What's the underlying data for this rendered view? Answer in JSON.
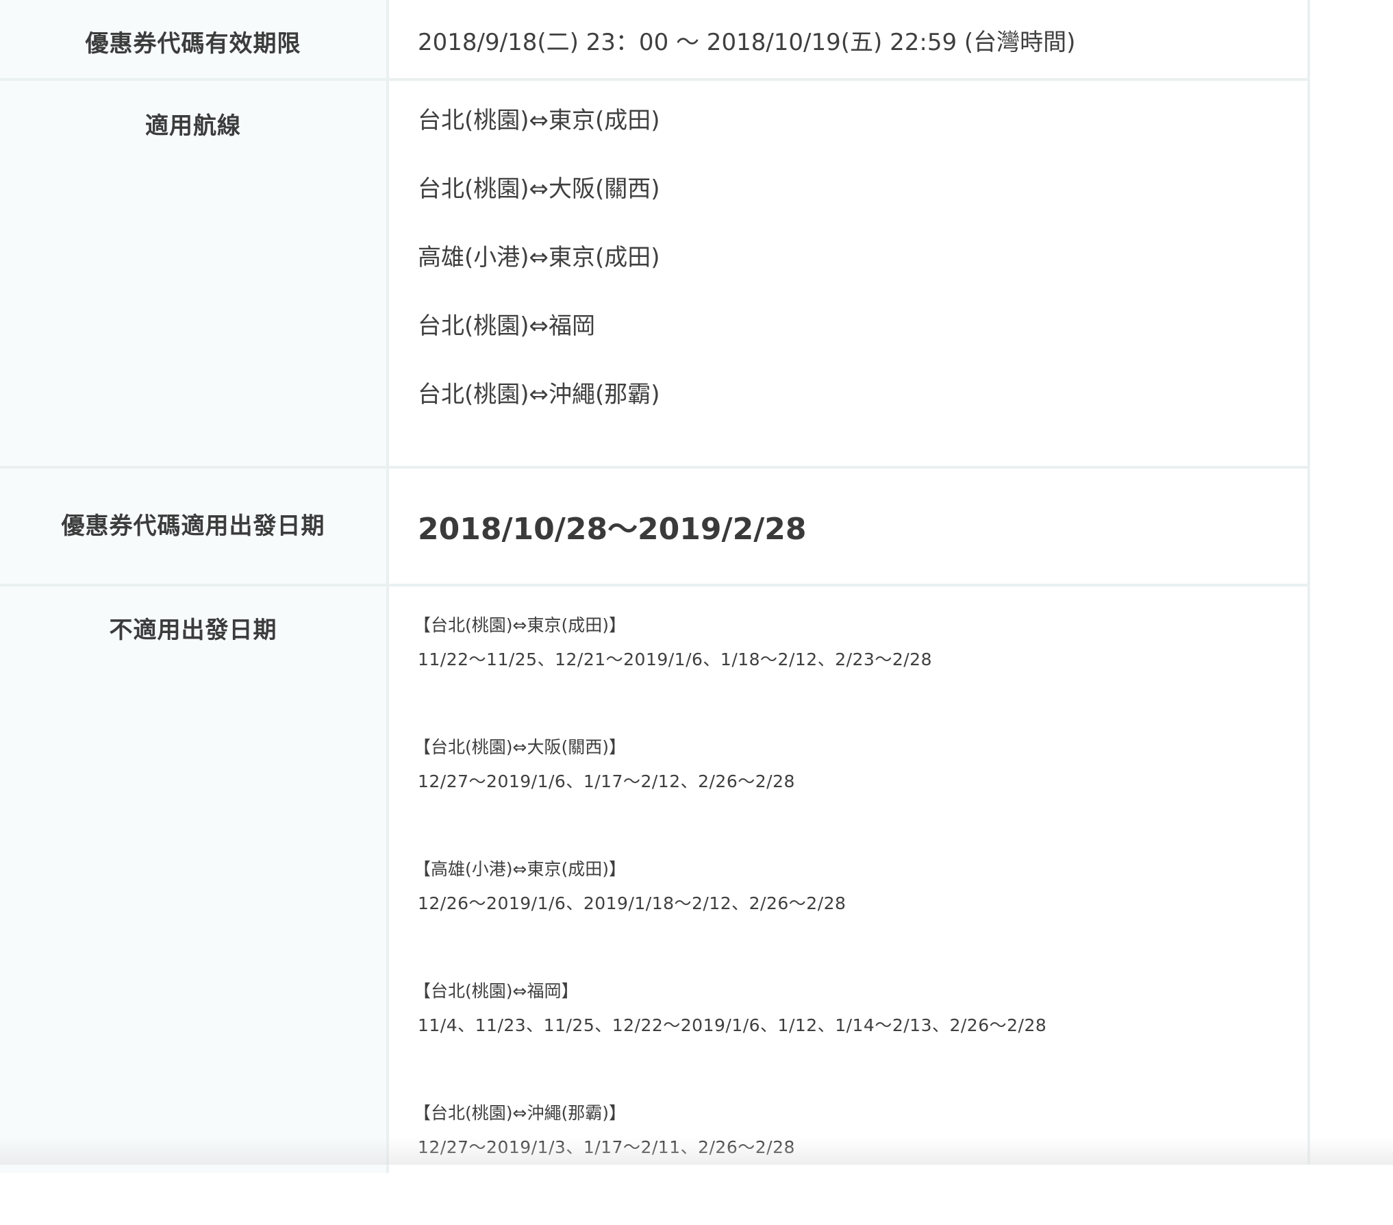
{
  "validity": {
    "label": "優惠券代碼有效期限",
    "value": "2018/9/18(二) 23：00 〜 2018/10/19(五) 22:59 (台灣時間)"
  },
  "routes": {
    "label": "適用航線",
    "items": [
      "台北(桃園)⇔東京(成田)",
      "台北(桃園)⇔大阪(關西)",
      "高雄(小港)⇔東京(成田)",
      "台北(桃園)⇔福岡",
      "台北(桃園)⇔沖繩(那霸)"
    ]
  },
  "departure": {
    "label": "優惠券代碼適用出發日期",
    "value": "2018/10/28〜2019/2/28"
  },
  "blackout": {
    "label": "不適用出發日期",
    "items": [
      {
        "route": "【台北(桃園)⇔東京(成田)】",
        "dates": "11/22〜11/25、12/21〜2019/1/6、1/18〜2/12、2/23〜2/28"
      },
      {
        "route": "【台北(桃園)⇔大阪(關西)】",
        "dates": "12/27〜2019/1/6、1/17〜2/12、2/26〜2/28"
      },
      {
        "route": "【高雄(小港)⇔東京(成田)】",
        "dates": "12/26〜2019/1/6、2019/1/18〜2/12、2/26〜2/28"
      },
      {
        "route": "【台北(桃園)⇔福岡】",
        "dates": "11/4、11/23、11/25、12/22〜2019/1/6、1/12、1/14〜2/13、2/26〜2/28"
      },
      {
        "route": "【台北(桃園)⇔沖繩(那霸)】",
        "dates": "12/27〜2019/1/3、1/17〜2/11、2/26〜2/28"
      }
    ]
  }
}
